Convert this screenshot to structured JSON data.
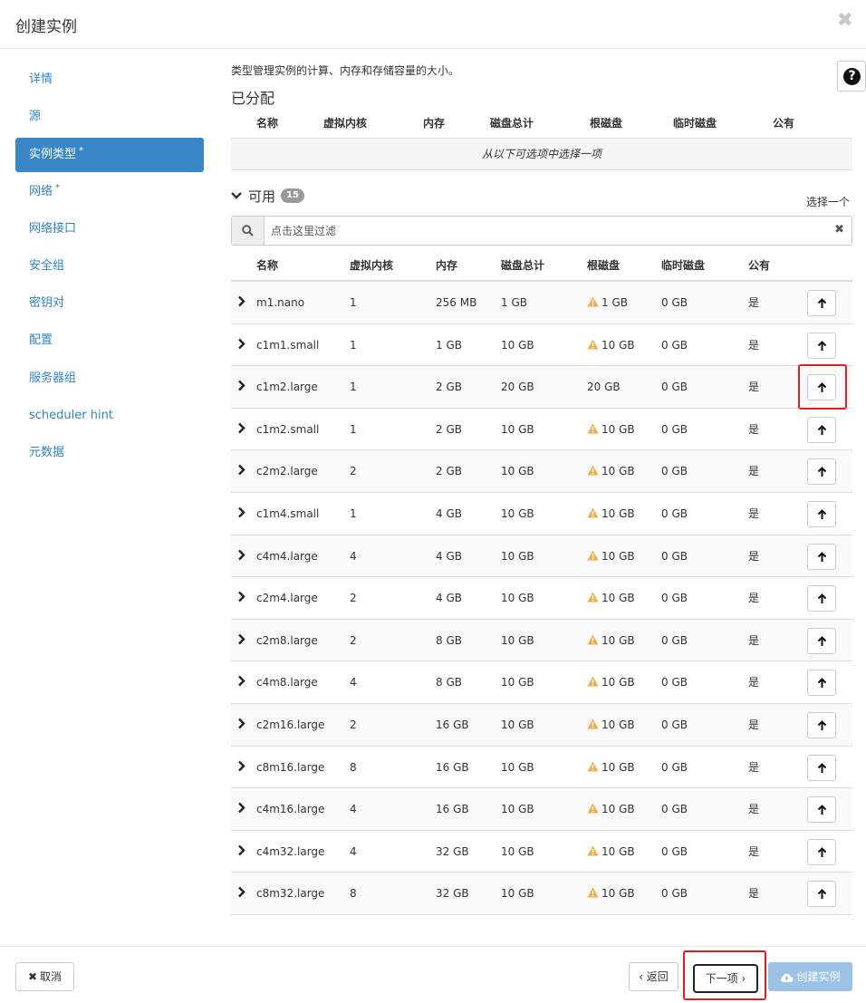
{
  "modal": {
    "title": "创建实例",
    "close_glyph": "✖"
  },
  "sidebar": {
    "items": [
      {
        "label": "详情",
        "required": false,
        "active": false
      },
      {
        "label": "源",
        "required": false,
        "active": false
      },
      {
        "label": "实例类型",
        "required": true,
        "active": true
      },
      {
        "label": "网络",
        "required": true,
        "active": false
      },
      {
        "label": "网络接口",
        "required": false,
        "active": false
      },
      {
        "label": "安全组",
        "required": false,
        "active": false
      },
      {
        "label": "密钥对",
        "required": false,
        "active": false
      },
      {
        "label": "配置",
        "required": false,
        "active": false
      },
      {
        "label": "服务器组",
        "required": false,
        "active": false
      },
      {
        "label": "scheduler hint",
        "required": false,
        "active": false
      },
      {
        "label": "元数据",
        "required": false,
        "active": false
      }
    ],
    "required_marker": "*"
  },
  "help": {
    "glyph": "?"
  },
  "content": {
    "description": "类型管理实例的计算、内存和存储容量的大小。",
    "allocated": {
      "title": "已分配",
      "columns": [
        "名称",
        "虚拟内核",
        "内存",
        "磁盘总计",
        "根磁盘",
        "临时磁盘",
        "公有"
      ],
      "empty_text": "从以下可选项中选择一项"
    },
    "available": {
      "title": "可用",
      "count": "15",
      "select_hint": "选择一个",
      "filter_placeholder": "点击这里过滤",
      "columns": [
        "名称",
        "虚拟内核",
        "内存",
        "磁盘总计",
        "根磁盘",
        "临时磁盘",
        "公有"
      ],
      "rows": [
        {
          "name": "m1.nano",
          "vcpus": "1",
          "ram": "256 MB",
          "disk": "1 GB",
          "root": "1 GB",
          "root_warn": true,
          "ephemeral": "0 GB",
          "public": "是"
        },
        {
          "name": "c1m1.small",
          "vcpus": "1",
          "ram": "1 GB",
          "disk": "10 GB",
          "root": "10 GB",
          "root_warn": true,
          "ephemeral": "0 GB",
          "public": "是"
        },
        {
          "name": "c1m2.large",
          "vcpus": "1",
          "ram": "2 GB",
          "disk": "20 GB",
          "root": "20 GB",
          "root_warn": false,
          "ephemeral": "0 GB",
          "public": "是"
        },
        {
          "name": "c1m2.small",
          "vcpus": "1",
          "ram": "2 GB",
          "disk": "10 GB",
          "root": "10 GB",
          "root_warn": true,
          "ephemeral": "0 GB",
          "public": "是"
        },
        {
          "name": "c2m2.large",
          "vcpus": "2",
          "ram": "2 GB",
          "disk": "10 GB",
          "root": "10 GB",
          "root_warn": true,
          "ephemeral": "0 GB",
          "public": "是"
        },
        {
          "name": "c1m4.small",
          "vcpus": "1",
          "ram": "4 GB",
          "disk": "10 GB",
          "root": "10 GB",
          "root_warn": true,
          "ephemeral": "0 GB",
          "public": "是"
        },
        {
          "name": "c4m4.large",
          "vcpus": "4",
          "ram": "4 GB",
          "disk": "10 GB",
          "root": "10 GB",
          "root_warn": true,
          "ephemeral": "0 GB",
          "public": "是"
        },
        {
          "name": "c2m4.large",
          "vcpus": "2",
          "ram": "4 GB",
          "disk": "10 GB",
          "root": "10 GB",
          "root_warn": true,
          "ephemeral": "0 GB",
          "public": "是"
        },
        {
          "name": "c2m8.large",
          "vcpus": "2",
          "ram": "8 GB",
          "disk": "10 GB",
          "root": "10 GB",
          "root_warn": true,
          "ephemeral": "0 GB",
          "public": "是"
        },
        {
          "name": "c4m8.large",
          "vcpus": "4",
          "ram": "8 GB",
          "disk": "10 GB",
          "root": "10 GB",
          "root_warn": true,
          "ephemeral": "0 GB",
          "public": "是"
        },
        {
          "name": "c2m16.large",
          "vcpus": "2",
          "ram": "16 GB",
          "disk": "10 GB",
          "root": "10 GB",
          "root_warn": true,
          "ephemeral": "0 GB",
          "public": "是"
        },
        {
          "name": "c8m16.large",
          "vcpus": "8",
          "ram": "16 GB",
          "disk": "10 GB",
          "root": "10 GB",
          "root_warn": true,
          "ephemeral": "0 GB",
          "public": "是"
        },
        {
          "name": "c4m16.large",
          "vcpus": "4",
          "ram": "16 GB",
          "disk": "10 GB",
          "root": "10 GB",
          "root_warn": true,
          "ephemeral": "0 GB",
          "public": "是"
        },
        {
          "name": "c4m32.large",
          "vcpus": "4",
          "ram": "32 GB",
          "disk": "10 GB",
          "root": "10 GB",
          "root_warn": true,
          "ephemeral": "0 GB",
          "public": "是"
        },
        {
          "name": "c8m32.large",
          "vcpus": "8",
          "ram": "32 GB",
          "disk": "10 GB",
          "root": "10 GB",
          "root_warn": true,
          "ephemeral": "0 GB",
          "public": "是"
        }
      ]
    }
  },
  "footer": {
    "cancel_label": "取消",
    "back_label": "‹ 返回",
    "next_label": "下一项 ›",
    "create_label": "创建实例"
  },
  "colors": {
    "accent": "#3a87c8",
    "warning": "#f0ad4e",
    "highlight": "#e02020",
    "create_disabled": "#9cc3e6"
  }
}
